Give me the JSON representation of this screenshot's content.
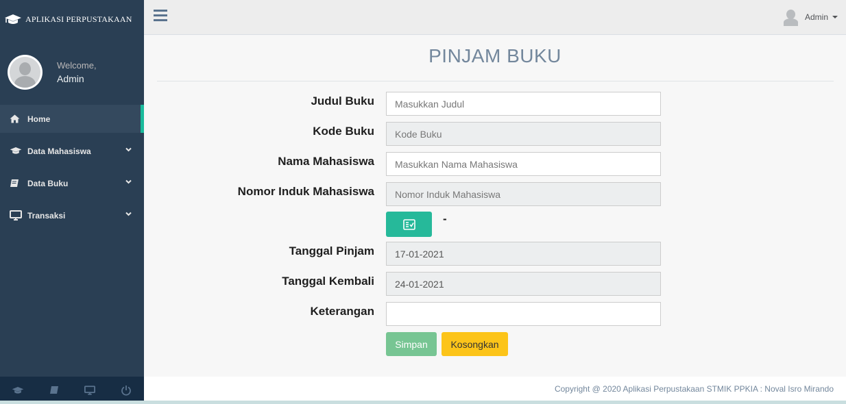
{
  "sidebar": {
    "brand": "APLIKASI PERPUSTAKAAN",
    "welcome": "Welcome,",
    "user": "Admin",
    "items": [
      {
        "label": "Home",
        "icon": "home-icon",
        "active": true
      },
      {
        "label": "Data Mahasiswa",
        "icon": "graduation-cap-icon",
        "active": false
      },
      {
        "label": "Data Buku",
        "icon": "book-icon",
        "active": false
      },
      {
        "label": "Transaksi",
        "icon": "desktop-icon",
        "active": false
      }
    ],
    "footer_icons": [
      "graduation-cap-icon",
      "book-icon",
      "desktop-icon",
      "power-icon"
    ]
  },
  "topnav": {
    "user": "Admin"
  },
  "page": {
    "title": "PINJAM BUKU"
  },
  "form": {
    "judul_label": "Judul Buku",
    "judul_placeholder": "Masukkan Judul",
    "kode_label": "Kode Buku",
    "kode_placeholder": "Kode Buku",
    "nama_label": "Nama Mahasiswa",
    "nama_placeholder": "Masukkan Nama Mahasiswa",
    "nim_label": "Nomor Induk Mahasiswa",
    "nim_placeholder": "Nomor Induk Mahasiswa",
    "selected_text": "-",
    "tgl_pinjam_label": "Tanggal Pinjam",
    "tgl_pinjam_value": "17-01-2021",
    "tgl_kembali_label": "Tanggal Kembali",
    "tgl_kembali_value": "24-01-2021",
    "keterangan_label": "Keterangan",
    "keterangan_value": "",
    "save_label": "Simpan",
    "clear_label": "Kosongkan"
  },
  "footer": {
    "text": "Copyright @ 2020 Aplikasi Perpustakaan STMIK PPKIA : Noval Isro Mirando"
  },
  "colors": {
    "sidebar_bg": "#2a3f54",
    "accent": "#26b99a",
    "save": "#77c593",
    "clear": "#fcc419"
  }
}
